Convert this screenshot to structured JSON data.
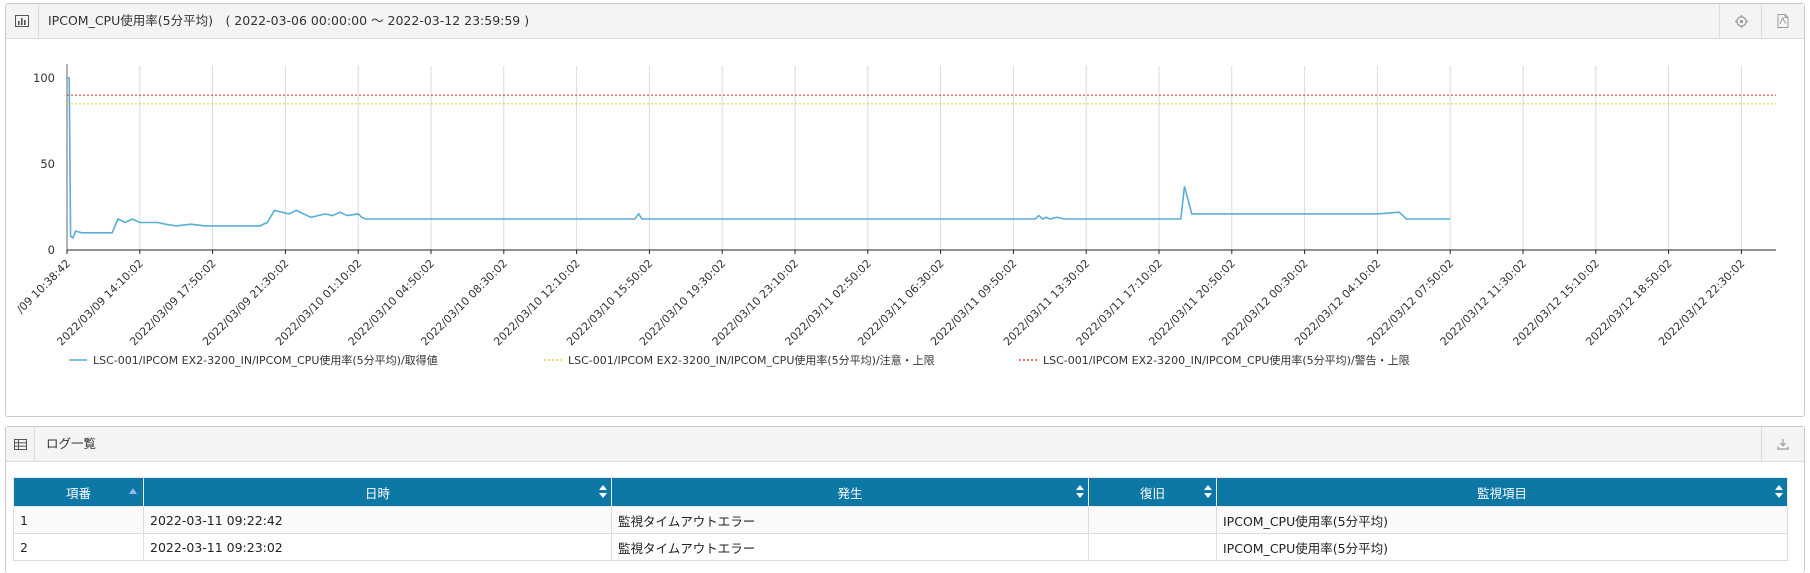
{
  "chart_panel": {
    "title": "IPCOM_CPU使用率(5分平均)　( 2022-03-06 00:00:00 ～ 2022-03-12 23:59:59 )",
    "settings_icon": "gear-icon",
    "export_icon": "pdf-icon"
  },
  "chart_data": {
    "type": "line",
    "ylim": [
      0,
      100
    ],
    "y_ticks": [
      "0",
      "50",
      "100"
    ],
    "x_tick_labels": [
      "/09 10:38:42",
      "2022/03/09 14:10:02",
      "2022/03/09 17:50:02",
      "2022/03/09 21:30:02",
      "2022/03/10 01:10:02",
      "2022/03/10 04:50:02",
      "2022/03/10 08:30:02",
      "2022/03/10 12:10:02",
      "2022/03/10 15:50:02",
      "2022/03/10 19:30:02",
      "2022/03/10 23:10:02",
      "2022/03/11 02:50:02",
      "2022/03/11 06:30:02",
      "2022/03/11 09:50:02",
      "2022/03/11 13:30:02",
      "2022/03/11 17:10:02",
      "2022/03/11 20:50:02",
      "2022/03/12 00:30:02",
      "2022/03/12 04:10:02",
      "2022/03/12 07:50:02",
      "2022/03/12 11:30:02",
      "2022/03/12 15:10:02",
      "2022/03/12 18:50:02",
      "2022/03/12 22:30:02"
    ],
    "x_index_range": [
      0,
      23.5
    ],
    "series": [
      {
        "name": "LSC-001/IPCOM EX2-3200_IN/IPCOM_CPU使用率(5分平均)/取得値",
        "color": "#5aaed5",
        "style": "solid",
        "x": [
          0,
          0.03,
          0.05,
          0.08,
          0.12,
          0.2,
          0.3,
          0.4,
          0.5,
          0.55,
          0.62,
          0.7,
          0.8,
          0.9,
          1.0,
          1.15,
          1.25,
          1.35,
          1.5,
          1.7,
          1.9,
          2.0,
          2.2,
          2.3,
          2.45,
          2.55,
          2.65,
          2.75,
          2.85,
          2.95,
          3.05,
          3.15,
          3.25,
          3.35,
          3.45,
          3.55,
          3.65,
          3.75,
          3.85,
          4.0,
          4.05,
          4.1,
          4.5,
          5.0,
          5.2,
          5.3,
          5.5,
          5.8,
          6.0,
          6.2,
          6.3,
          6.5,
          7.0,
          7.5,
          7.7,
          7.8,
          7.85,
          7.9,
          8.0,
          8.05,
          8.15,
          8.3,
          8.45,
          8.6,
          8.75,
          8.85,
          8.95,
          9.0,
          9.1,
          9.3,
          9.5,
          10.0,
          10.5,
          11.0,
          11.2,
          11.3,
          11.5,
          12.0,
          12.5,
          13.0,
          13.3,
          13.35,
          13.4,
          13.45,
          13.5,
          13.6,
          13.7,
          14.0,
          14.5,
          15.0,
          15.3,
          15.35,
          15.45,
          15.5,
          16.0,
          16.5,
          17.0,
          17.5,
          18.0,
          18.3,
          18.4,
          18.5,
          18.6,
          18.7,
          18.8,
          19.0
        ],
        "values": [
          100,
          100,
          8,
          7,
          11,
          10,
          10,
          10,
          10,
          10,
          10,
          18,
          16,
          18,
          16,
          16,
          16,
          15,
          14,
          15,
          14,
          14,
          14,
          14,
          14,
          14,
          14,
          16,
          23,
          22,
          21,
          23,
          21,
          19,
          20,
          21,
          20,
          22,
          20,
          21,
          19,
          18,
          18,
          18,
          18,
          18,
          18,
          18,
          18,
          18,
          18,
          18,
          18,
          18,
          18,
          18,
          21,
          18,
          18,
          18,
          18,
          18,
          18,
          18,
          18,
          18,
          18,
          18,
          18,
          18,
          18,
          18,
          18,
          18,
          18,
          18,
          18,
          18,
          18,
          18,
          18,
          20,
          18,
          19,
          18,
          19,
          18,
          18,
          18,
          18,
          18,
          37,
          21,
          21,
          21,
          21,
          21,
          21,
          21,
          22,
          18,
          18,
          18,
          18,
          18,
          18
        ]
      },
      {
        "name": "LSC-001/IPCOM EX2-3200_IN/IPCOM_CPU使用率(5分平均)/注意・上限",
        "color": "#e6d44a",
        "style": "dotted",
        "value": 85
      },
      {
        "name": "LSC-001/IPCOM EX2-3200_IN/IPCOM_CPU使用率(5分平均)/警告・上限",
        "color": "#e04545",
        "style": "dotted",
        "value": 90
      }
    ],
    "grid": true,
    "legend_position": "bottom"
  },
  "log_panel": {
    "title": "ログ一覧",
    "download_icon": "download-icon",
    "columns": [
      "項番",
      "日時",
      "発生",
      "復旧",
      "監視項目"
    ],
    "rows": [
      [
        "1",
        "2022-03-11 09:22:42",
        "監視タイムアウトエラー",
        "",
        "IPCOM_CPU使用率(5分平均)"
      ],
      [
        "2",
        "2022-03-11 09:23:02",
        "監視タイムアウトエラー",
        "",
        "IPCOM_CPU使用率(5分平均)"
      ]
    ]
  }
}
